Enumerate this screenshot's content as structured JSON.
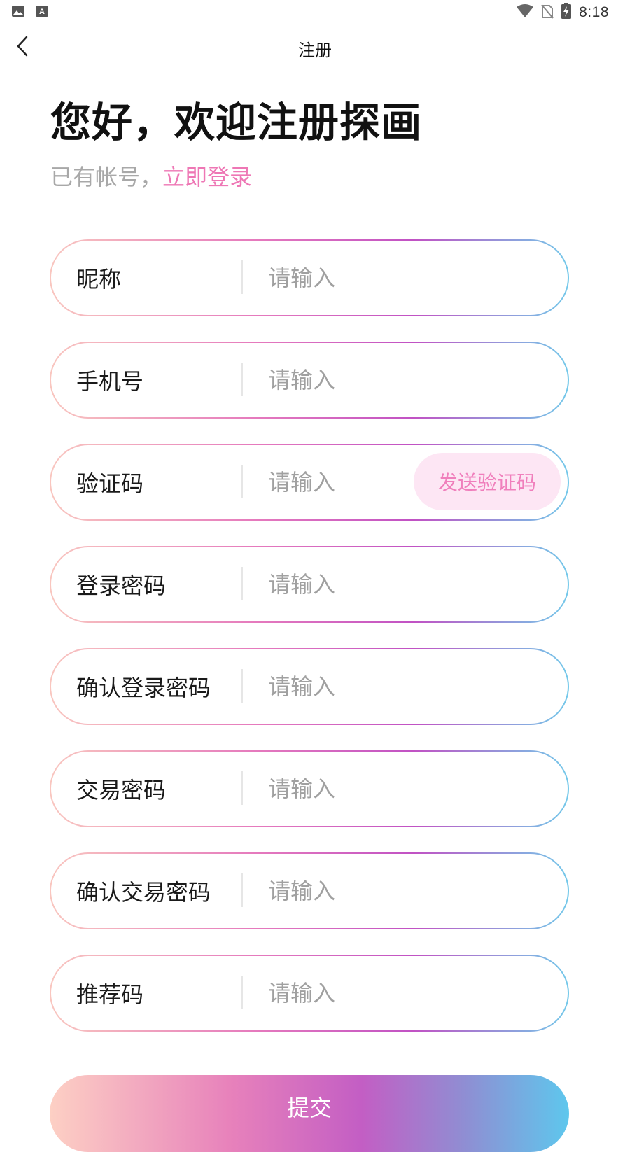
{
  "status_bar": {
    "time": "8:18",
    "icons": [
      "image-icon",
      "text-a-icon",
      "wifi-icon",
      "no-sim-icon",
      "battery-charging-icon"
    ]
  },
  "header": {
    "title": "注册",
    "back_icon": "chevron-left-icon"
  },
  "welcome": {
    "title": "您好，欢迎注册探画",
    "have_account": "已有帐号，",
    "login_link": "立即登录"
  },
  "form": {
    "fields": [
      {
        "label": "昵称",
        "placeholder": "请输入"
      },
      {
        "label": "手机号",
        "placeholder": "请输入"
      },
      {
        "label": "验证码",
        "placeholder": "请输入",
        "action": "发送验证码"
      },
      {
        "label": "登录密码",
        "placeholder": "请输入"
      },
      {
        "label": "确认登录密码",
        "placeholder": "请输入"
      },
      {
        "label": "交易密码",
        "placeholder": "请输入"
      },
      {
        "label": "确认交易密码",
        "placeholder": "请输入"
      },
      {
        "label": "推荐码",
        "placeholder": "请输入"
      }
    ]
  },
  "submit_label": "提交",
  "colors": {
    "accent_pink": "#ee77b5",
    "send_code_bg": "#fde6f4",
    "gradient_start": "#fdd0c4",
    "gradient_mid": "#c35ec4",
    "gradient_end": "#5ec7ed"
  }
}
